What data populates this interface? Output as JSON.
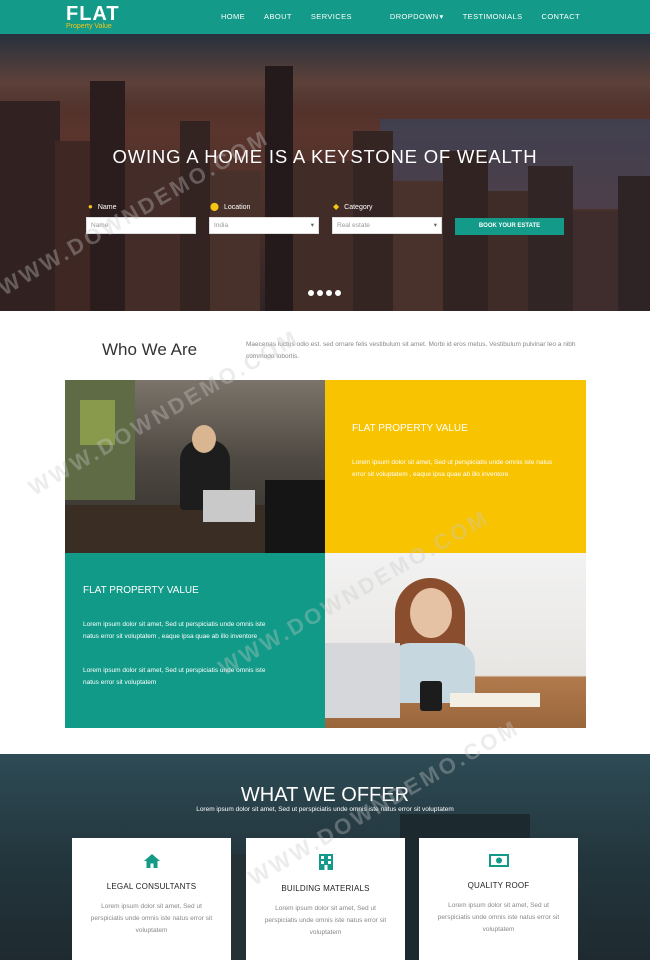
{
  "nav": {
    "brand": "FLAT",
    "brand_sub": "Property Value",
    "items": [
      "HOME",
      "ABOUT",
      "SERVICES",
      "DROPDOWN",
      "TESTIMONIALS",
      "CONTACT"
    ]
  },
  "hero": {
    "title": "OWING A HOME IS A KEYSTONE OF WEALTH",
    "form": {
      "name_label": "Name",
      "name_placeholder": "Name",
      "location_label": "Location",
      "location_value": "India",
      "category_label": "Category",
      "category_value": "Real estate",
      "button": "BOOK YOUR ESTATE"
    },
    "slides": 4
  },
  "who": {
    "title": "Who We Are",
    "text": "Maecenas luctus odio est. sed ornare felis vestibulum sit amet. Morbi id eros metus. Vestibulum pulvinar leo a nibh commodo lobortis."
  },
  "features": {
    "yellow_title": "FLAT PROPERTY VALUE",
    "yellow_text": "Lorem ipsum dolor sit amet, Sed ut perspiciatis unde omnis iste natus error sit voluptatem , eaque ipsa quae ab illo inventore",
    "teal_title": "FLAT PROPERTY VALUE",
    "teal_text_1": "Lorem ipsum dolor sit amet, Sed ut perspiciatis unde omnis iste natus error sit voluptatem , eaque ipsa quae ab illo inventore",
    "teal_text_2": "Lorem ipsum dolor sit amet, Sed ut perspiciatis unde omnis iste natus error sit voluptatem"
  },
  "offer": {
    "title": "WHAT WE OFFER",
    "subtitle": "Lorem ipsum dolor sit amet, Sed ut perspiciatis unde omnis iste natus error sit voluptatem",
    "cards": [
      {
        "icon": "home-icon",
        "title": "LEGAL CONSULTANTS",
        "text": "Lorem ipsum dolor sit amet, Sed ut perspiciatis unde omnis iste natus error sit voluptatem"
      },
      {
        "icon": "building-icon",
        "title": "BUILDING MATERIALS",
        "text": "Lorem ipsum dolor sit amet, Sed ut perspiciatis unde omnis iste natus error sit voluptatem"
      },
      {
        "icon": "money-icon",
        "title": "QUALITY ROOF",
        "text": "Lorem ipsum dolor sit amet, Sed ut perspiciatis unde omnis iste natus error sit voluptatem"
      }
    ]
  },
  "watermark": "WWW.DOWNDEMO.COM",
  "colors": {
    "primary": "#139a88",
    "accent": "#f8c301"
  }
}
